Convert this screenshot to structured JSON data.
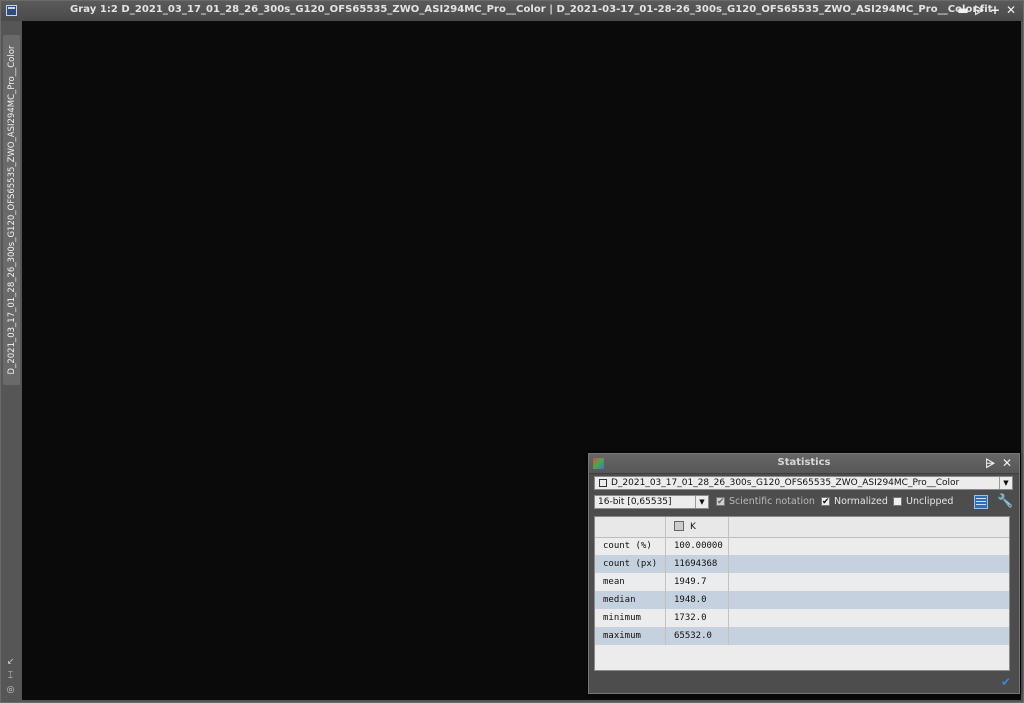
{
  "image_window": {
    "title": "Gray 1:2 D_2021_03_17_01_28_26_300s_G120_OFS65535_ZWO_ASI294MC_Pro__Color | D_2021-03-17_01-28-26_300s_G120_OFS65535_ZWO_ASI294MC_Pro__Color.fit",
    "controls": {
      "minimize": "▬",
      "shade": "⩥",
      "maximize": "+",
      "close": "✕"
    },
    "side_tab_label": "D_2021_03_17_01_28_26_300s_G120_OFS65535_ZWO_ASI294MC_Pro__Color",
    "side_icons": [
      "↙",
      "⌶",
      "◎"
    ],
    "canvas_color": "#0a0a0a"
  },
  "statistics": {
    "title": "Statistics",
    "controls": {
      "shade": "⩥",
      "close": "✕"
    },
    "view": "D_2021_03_17_01_28_26_300s_G120_OFS65535_ZWO_ASI294MC_Pro__Color",
    "bit_depth": "16-bit [0,65535]",
    "options": {
      "scientific_notation": {
        "label": "Scientific notation",
        "checked": true,
        "enabled": false
      },
      "normalized": {
        "label": "Normalized",
        "checked": true,
        "enabled": true
      },
      "unclipped": {
        "label": "Unclipped",
        "checked": false,
        "enabled": true
      }
    },
    "table": {
      "channel_header": "K",
      "rows": [
        {
          "label": "count (%)",
          "value": "100.00000"
        },
        {
          "label": "count (px)",
          "value": "11694368"
        },
        {
          "label": "mean",
          "value": "1949.7"
        },
        {
          "label": "median",
          "value": "1948.0"
        },
        {
          "label": "minimum",
          "value": "1732.0"
        },
        {
          "label": "maximum",
          "value": "65532.0"
        }
      ]
    },
    "check_mark": "✔",
    "arrow_glyph": "▼",
    "wrench_glyph": "🔧"
  }
}
